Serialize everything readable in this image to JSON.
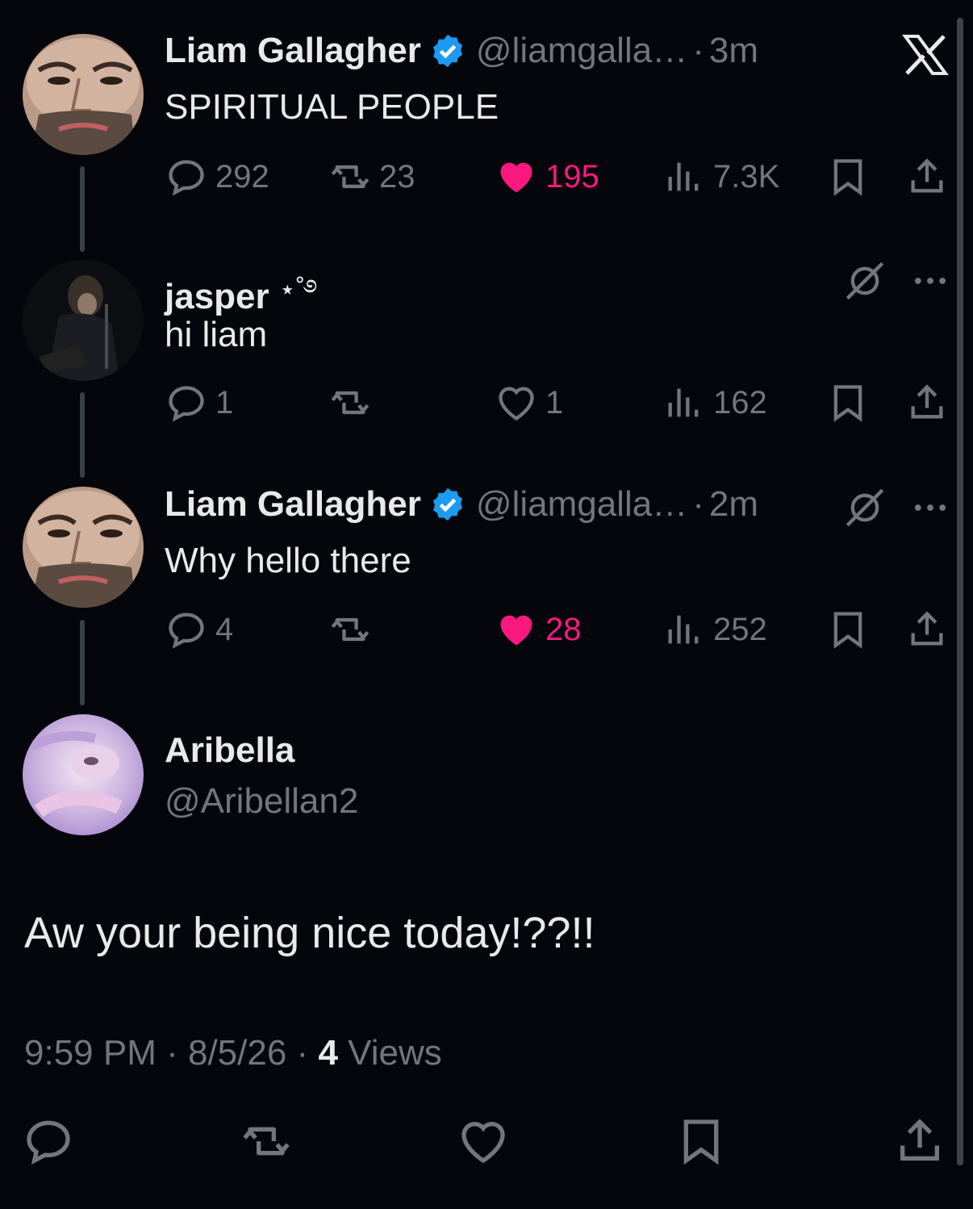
{
  "colors": {
    "background": "#05060b",
    "text": "#e7e9ea",
    "muted": "#71767b",
    "like": "#f91880",
    "verified": "#1d9bf0"
  },
  "tweets": [
    {
      "name": "Liam Gallagher",
      "handle": "@liamgalla…",
      "sep": "·",
      "time": "3m",
      "text": "SPIRITUAL PEOPLE",
      "replies": "292",
      "retweets": "23",
      "likes": "195",
      "views": "7.3K",
      "liked": true
    },
    {
      "name": "jasper",
      "name_decor": "⋆˚࿔",
      "text": "hi liam",
      "replies": "1",
      "retweets": "",
      "likes": "1",
      "views": "162",
      "liked": false
    },
    {
      "name": "Liam Gallagher",
      "handle": "@liamgalla…",
      "sep": "·",
      "time": "2m",
      "text": "Why hello there",
      "replies": "4",
      "retweets": "",
      "likes": "28",
      "views": "252",
      "liked": true
    }
  ],
  "main": {
    "name": "Aribella",
    "handle": "@Aribellan2",
    "text": "Aw your being nice today!??!!",
    "time": "9:59 PM",
    "dot1": " · ",
    "date": "8/5/26",
    "dot2": " · ",
    "views_count": "4",
    "views_label": " Views"
  },
  "icons": {
    "close": "x-logo-icon",
    "reply": "reply-icon",
    "retweet": "retweet-icon",
    "like": "heart-icon",
    "views": "views-icon",
    "bookmark": "bookmark-icon",
    "share": "share-icon",
    "grok": "grok-icon",
    "more": "more-icon"
  }
}
